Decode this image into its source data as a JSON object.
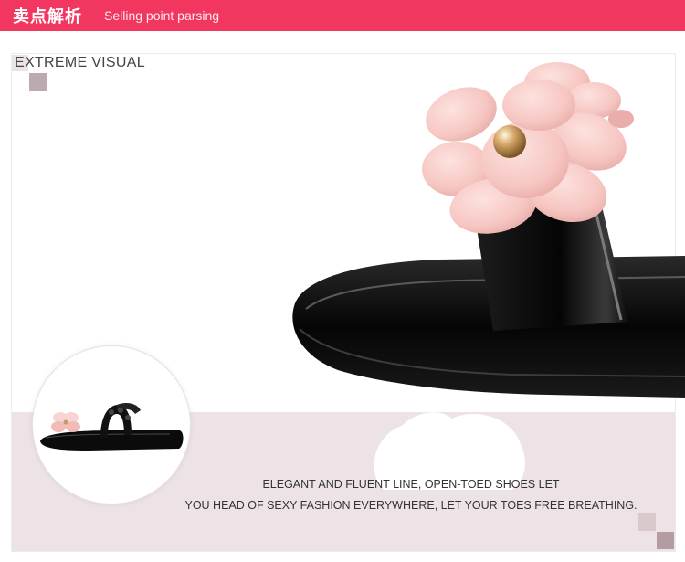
{
  "header": {
    "title": "卖点解析",
    "subtitle": "Selling point parsing"
  },
  "section": {
    "heading": "EXTREME VISUAL"
  },
  "caption": {
    "line1": "ELEGANT AND FLUENT LINE, OPEN-TOED SHOES LET",
    "line2": "YOU HEAD OF SEXY FASHION EVERYWHERE, LET YOUR TOES FREE BREATHING."
  },
  "colors": {
    "header_bg": "#f1365f",
    "band": "#ede3e6",
    "flower": "#f6c9c6",
    "shoe": "#0b0b0b"
  }
}
